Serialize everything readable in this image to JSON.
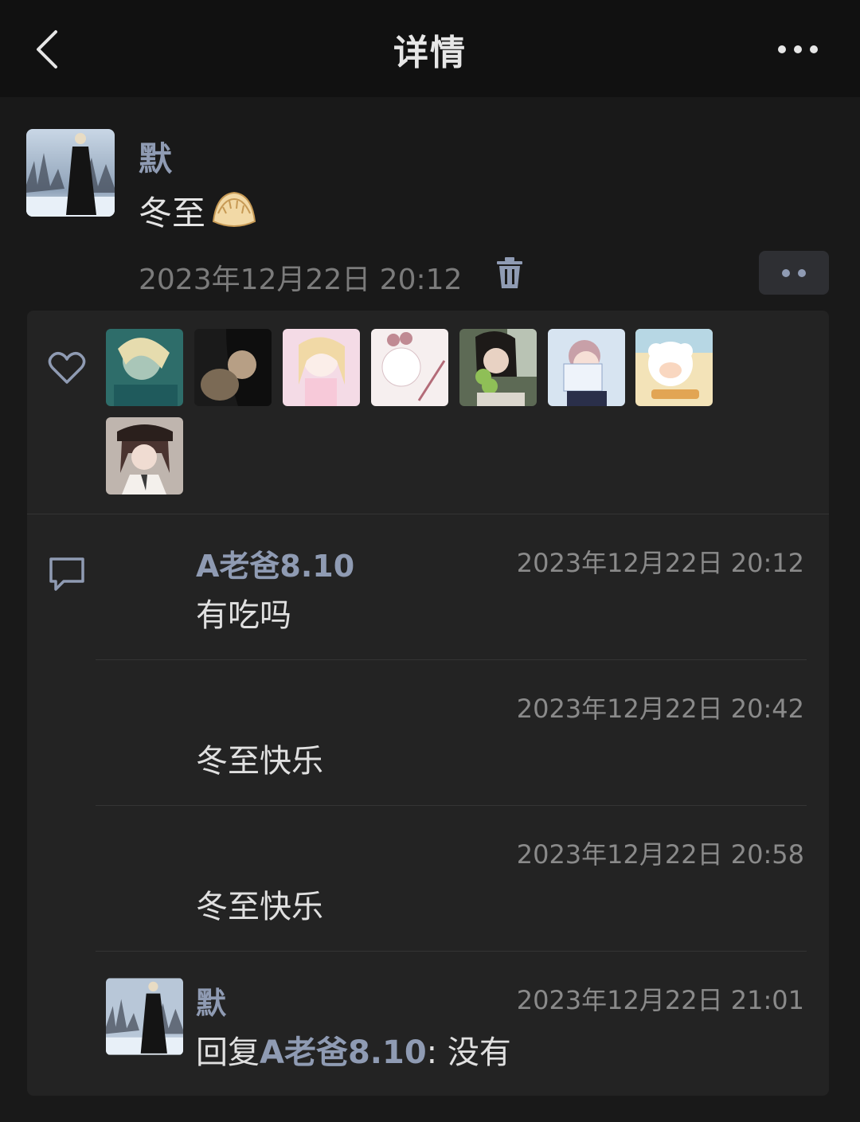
{
  "nav": {
    "title": "详情",
    "back_icon": "chevron-left-icon",
    "more_icon": "more-dots-icon"
  },
  "post": {
    "author": "默",
    "text": "冬至",
    "emoji_icon": "dumpling-emoji",
    "time": "2023年12月22日 20:12",
    "delete_icon": "trash-icon"
  },
  "likes": {
    "icon": "heart-icon",
    "count_avatars": 8
  },
  "comments_icon": "comment-bubble-icon",
  "comments": [
    {
      "name": "A老爸8.10",
      "time": "2023年12月22日 20:12",
      "text": "有吃吗"
    },
    {
      "name": "",
      "time": "2023年12月22日 20:42",
      "text": "冬至快乐"
    },
    {
      "name": "",
      "time": "2023年12月22日 20:58",
      "text": "冬至快乐"
    },
    {
      "name": "默",
      "time": "2023年12月22日 21:01",
      "reply_prefix": "回复",
      "reply_to": "A老爸8.10",
      "reply_sep": ": ",
      "reply_text": "没有"
    }
  ],
  "colors": {
    "background": "#191919",
    "navbar": "#111111",
    "card": "#232323",
    "name_link": "#8f9bb3",
    "timestamp": "#7b7b7b"
  }
}
